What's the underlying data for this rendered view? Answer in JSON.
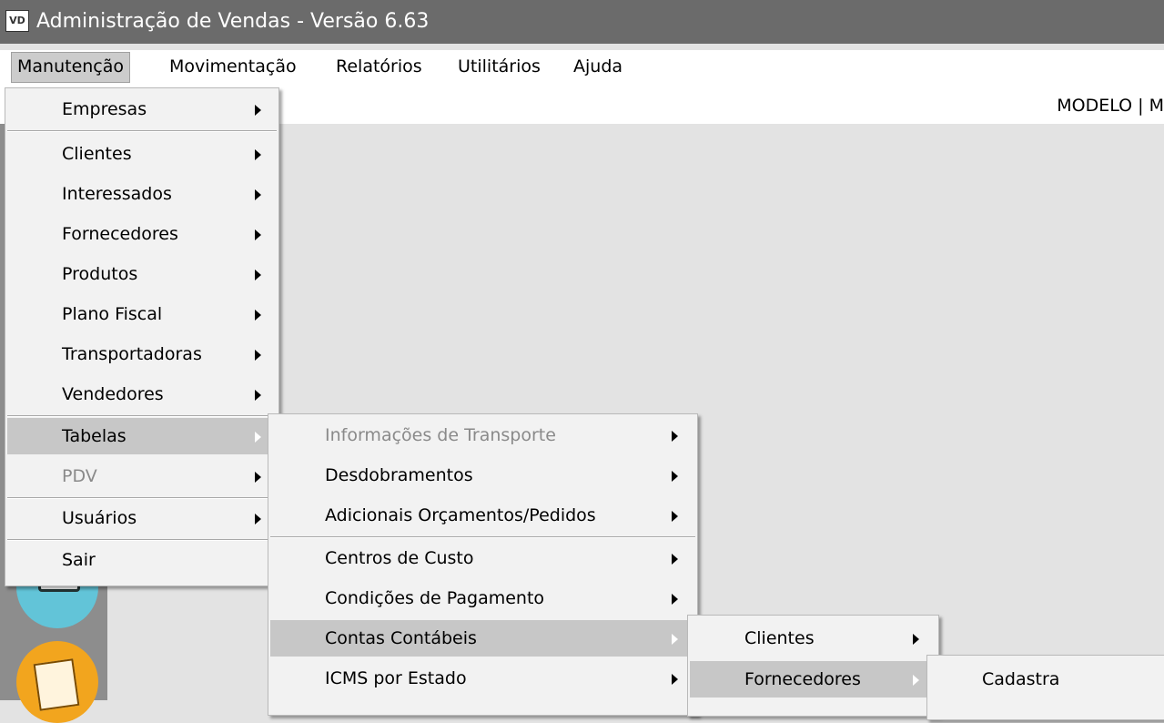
{
  "window": {
    "icon_text": "VD",
    "title": "Administração de Vendas - Versão 6.63"
  },
  "menubar": [
    "Manutenção",
    "Movimentação",
    "Relatórios",
    "Utilitários",
    "Ajuda"
  ],
  "status_strip": {
    "text": "MODELO | M"
  },
  "menu_main": [
    {
      "label": "Empresas"
    },
    {
      "label": "Clientes"
    },
    {
      "label": "Interessados"
    },
    {
      "label": "Fornecedores"
    },
    {
      "label": "Produtos"
    },
    {
      "label": "Plano Fiscal"
    },
    {
      "label": "Transportadoras"
    },
    {
      "label": "Vendedores"
    },
    {
      "label": "Tabelas"
    },
    {
      "label": "PDV"
    },
    {
      "label": "Usuários"
    },
    {
      "label": "Sair"
    }
  ],
  "menu_tabelas": [
    {
      "label": "Informações de Transporte"
    },
    {
      "label": "Desdobramentos"
    },
    {
      "label": "Adicionais Orçamentos/Pedidos"
    },
    {
      "label": "Centros de Custo"
    },
    {
      "label": "Condições de Pagamento"
    },
    {
      "label": "Contas Contábeis"
    },
    {
      "label": "ICMS por Estado"
    }
  ],
  "menu_contas": [
    {
      "label": "Clientes"
    },
    {
      "label": "Fornecedores"
    }
  ],
  "menu_fornecedores": [
    {
      "label": "Cadastra"
    }
  ]
}
